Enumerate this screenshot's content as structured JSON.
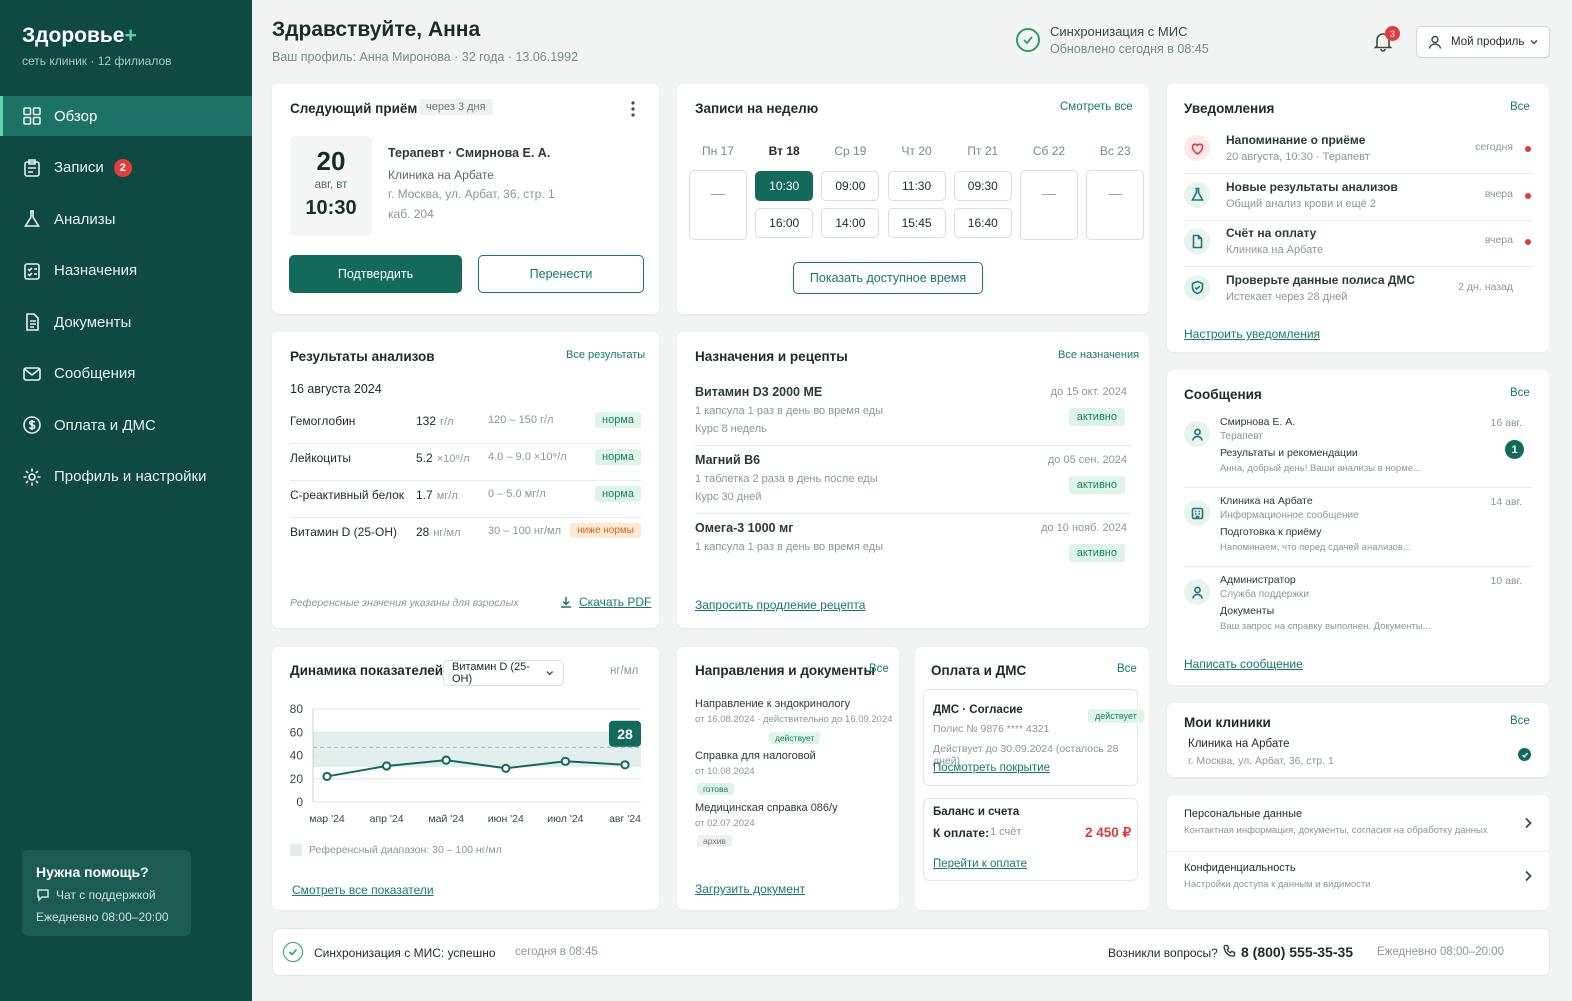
{
  "brand": {
    "name": "Здоровье",
    "plus": "+",
    "subtitle": "сеть клиник · 12 филиалов"
  },
  "nav": [
    {
      "label": "Обзор",
      "icon": "grid-icon",
      "active": true
    },
    {
      "label": "Записи",
      "icon": "clipboard-icon",
      "badge": "2"
    },
    {
      "label": "Анализы",
      "icon": "flask-icon"
    },
    {
      "label": "Назначения",
      "icon": "checklist-icon"
    },
    {
      "label": "Документы",
      "icon": "document-icon"
    },
    {
      "label": "Сообщения",
      "icon": "mail-icon"
    },
    {
      "label": "Оплата и ДМС",
      "icon": "dollar-circle-icon"
    },
    {
      "label": "Профиль и настройки",
      "icon": "gear-icon"
    }
  ],
  "help": {
    "title": "Нужна помощь?",
    "chat": "Чат с поддержкой",
    "hours": "Ежедневно 08:00–20:00"
  },
  "header": {
    "greeting": "Здравствуйте, Анна",
    "profile_line": "Ваш профиль: Анна Миронова · 32 года · 13.06.1992",
    "sync_title": "Синхронизация с МИС",
    "sync_time": "Обновлено сегодня в 08:45",
    "bell_count": "3",
    "profile_button": "Мой профиль"
  },
  "next_visit": {
    "title": "Следующий приём",
    "badge": "через 3 дня",
    "day": "20",
    "month_weekday": "авг, вт",
    "time": "10:30",
    "doctor": "Терапевт · Смирнова Е. А.",
    "clinic": "Клиника на Арбате",
    "address": "г. Москва, ул. Арбат, 36, стр. 1",
    "room": "каб. 204",
    "confirm": "Подтвердить",
    "reschedule": "Перенести"
  },
  "week": {
    "title": "Записи на неделю",
    "see_all": "Смотреть все",
    "days": [
      {
        "label": "Пн 17",
        "slots": []
      },
      {
        "label": "Вт 18",
        "slots": [
          "10:30",
          "16:00"
        ],
        "active": true
      },
      {
        "label": "Ср 19",
        "slots": [
          "09:00",
          "14:00"
        ]
      },
      {
        "label": "Чт 20",
        "slots": [
          "11:30",
          "15:45"
        ]
      },
      {
        "label": "Пт 21",
        "slots": [
          "09:30",
          "16:40"
        ]
      },
      {
        "label": "Сб 22",
        "slots": []
      },
      {
        "label": "Вс 23",
        "slots": []
      }
    ],
    "empty_mark": "—",
    "show_button": "Показать доступное время"
  },
  "notifications": {
    "title": "Уведомления",
    "all": "Все",
    "items": [
      {
        "title": "Напоминание о приёме",
        "sub": "20 августа, 10:30 · Терапевт",
        "time": "сегодня",
        "icon": "heart-icon",
        "unread": true
      },
      {
        "title": "Новые результаты анализов",
        "sub": "Общий анализ крови и ещё 2",
        "time": "вчера",
        "icon": "flask-icon",
        "unread": true
      },
      {
        "title": "Счёт на оплату",
        "sub": "Клиника на Арбате",
        "time": "вчера",
        "icon": "document-icon",
        "unread": true
      },
      {
        "title": "Проверьте данные полиса ДМС",
        "sub": "Истекает через 28 дней",
        "time": "2 дн. назад",
        "icon": "shield-icon",
        "unread": false
      }
    ],
    "configure": "Настроить уведомления"
  },
  "results": {
    "title": "Результаты анализов",
    "all": "Все результаты",
    "date": "16 августа 2024",
    "rows": [
      {
        "name": "Гемоглобин",
        "value": "132",
        "unit": "г/л",
        "range": "120 – 150 г/л",
        "status": "норма",
        "kind": "green"
      },
      {
        "name": "Лейкоциты",
        "value": "5.2",
        "unit": "×10⁹/л",
        "range": "4.0 – 9.0 ×10⁹/л",
        "status": "норма",
        "kind": "green"
      },
      {
        "name": "С-реактивный белок",
        "value": "1.7",
        "unit": "мг/л",
        "range": "0 – 5.0 мг/л",
        "status": "норма",
        "kind": "green"
      },
      {
        "name": "Витамин D (25-OH)",
        "value": "28",
        "unit": "нг/мл",
        "range": "30 – 100 нг/мл",
        "status": "ниже нормы",
        "kind": "orange"
      }
    ],
    "note": "Референсные значения указаны для взрослых",
    "pdf": "Скачать PDF"
  },
  "prescriptions": {
    "title": "Назначения и рецепты",
    "all": "Все назначения",
    "items": [
      {
        "name": "Витамин D3 2000 МЕ",
        "dose": "1 капсула 1 раз в день во время еды",
        "course": "Курс 8 недель",
        "until": "до 15 окт. 2024",
        "status": "активно"
      },
      {
        "name": "Магний B6",
        "dose": "1 таблетка 2 раза в день после еды",
        "course": "Курс 30 дней",
        "until": "до 05 сен. 2024",
        "status": "активно"
      },
      {
        "name": "Омега-3 1000 мг",
        "dose": "1 капсула 1 раз в день во время еды",
        "course": "",
        "until": "до 10 нояб. 2024",
        "status": "активно"
      }
    ],
    "renew": "Запросить продление рецепта"
  },
  "messages": {
    "title": "Сообщения",
    "all": "Все",
    "items": [
      {
        "from": "Смирнова Е. А.",
        "role": "Терапевт",
        "subject": "Результаты и рекомендации",
        "preview": "Анна, добрый день! Ваши анализы в норме...",
        "date": "16 авг.",
        "unread": "1",
        "icon": "user-icon"
      },
      {
        "from": "Клиника на Арбате",
        "role": "Информационное сообщение",
        "subject": "Подготовка к приёму",
        "preview": "Напоминаем, что перед сдачей анализов...",
        "date": "14 авг.",
        "unread": "",
        "icon": "building-icon"
      },
      {
        "from": "Администратор",
        "role": "Служба поддержки",
        "subject": "Документы",
        "preview": "Ваш запрос на справку выполнен. Документы...",
        "date": "10 авг.",
        "unread": "",
        "icon": "user-icon"
      }
    ],
    "write": "Написать сообщение"
  },
  "dynamics": {
    "title": "Динамика показателей",
    "select": "Витамин D (25-OH)",
    "unit": "нг/мл",
    "legend": "Референсный диапазон: 30 – 100 нг/мл",
    "all": "Смотреть все показатели"
  },
  "chart_data": {
    "type": "line",
    "x": [
      "мар '24",
      "апр '24",
      "май '24",
      "июн '24",
      "июл '24",
      "авг '24"
    ],
    "values": [
      22,
      31,
      36,
      29,
      35,
      32
    ],
    "highlight_label": "28",
    "ylim": [
      0,
      80
    ],
    "yticks": [
      0,
      20,
      40,
      60,
      80
    ],
    "reference_band": [
      30,
      60
    ],
    "reference_line": 47,
    "grid": true,
    "color": "#126a5d"
  },
  "referrals": {
    "title": "Направления и документы",
    "all": "Все",
    "items": [
      {
        "name": "Направление к эндокринологу",
        "meta": "от 16.08.2024 · действительно до 16.09.2024",
        "status": "действует",
        "kind": "green"
      },
      {
        "name": "Справка для налоговой",
        "meta": "от 10.08.2024",
        "status": "готова",
        "kind": "green"
      },
      {
        "name": "Медицинская справка 086/у",
        "meta": "от 02.07.2024",
        "status": "архив",
        "kind": "gray"
      }
    ],
    "upload": "Загрузить документ"
  },
  "payment": {
    "title": "Оплата и ДМС",
    "all": "Все",
    "dms_title": "ДМС · Согласие",
    "dms_status": "действует",
    "policy": "Полис № 9876 **** 4321",
    "valid": "Действует до 30.09.2024 (осталось 28 дней)",
    "coverage": "Посмотреть покрытие",
    "balance_title": "Баланс и счета",
    "due_label": "К оплате:",
    "due_count": "1 счёт",
    "due_amount": "2 450 ₽",
    "pay": "Перейти к оплате"
  },
  "clinics": {
    "title": "Мои клиники",
    "all": "Все",
    "name": "Клиника на Арбате",
    "address": "г. Москва, ул. Арбат, 36, стр. 1"
  },
  "settings": [
    {
      "title": "Персональные данные",
      "sub": "Контактная информация, документы, согласия на обработку данных"
    },
    {
      "title": "Конфиденциальность",
      "sub": "Настройки доступа к данным и видимости"
    }
  ],
  "footer": {
    "sync_label": "Синхронизация с МИС:",
    "sync_status": "успешно",
    "sync_time": "сегодня в 08:45",
    "question": "Возникли вопросы?",
    "phone": "8 (800) 555-35-35",
    "hours": "Ежедневно 08:00–20:00"
  },
  "colors": {
    "primary": "#126a5d",
    "sidebar": "#0f4a42",
    "accent": "#5fd3a6",
    "danger": "#e23b3b",
    "warning": "#d16a14"
  }
}
